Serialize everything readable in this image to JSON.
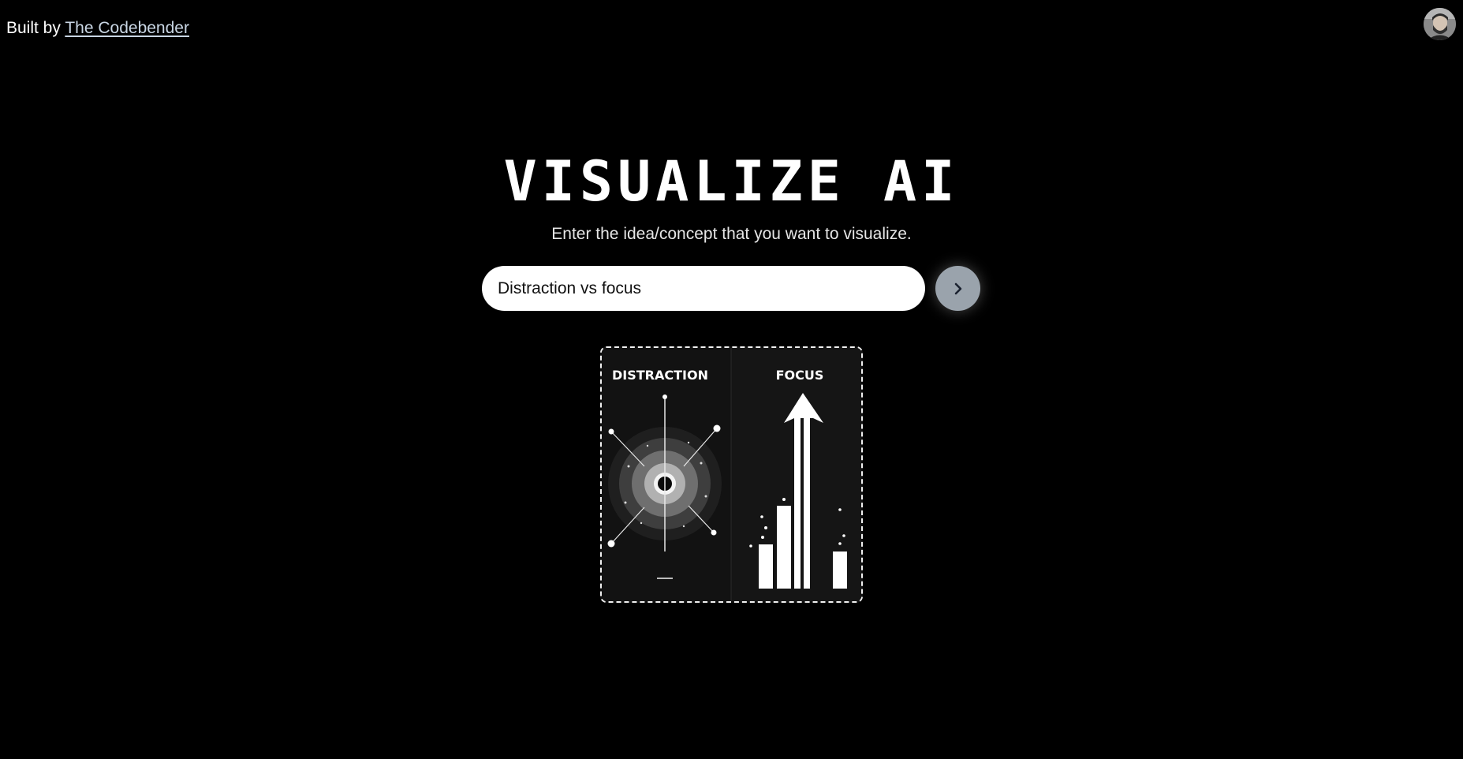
{
  "header": {
    "built_by_prefix": "Built by",
    "author_link": "The Codebender"
  },
  "hero": {
    "title": "VISUALIZE AI",
    "subtitle": "Enter the idea/concept that you want to visualize."
  },
  "search": {
    "value": "Distraction vs focus",
    "submit_icon": "chevron-right-icon"
  },
  "result": {
    "left_panel_label": "DISTRACTION",
    "right_panel_label": "FOCUS"
  },
  "colors": {
    "background": "#000000",
    "input_background": "#ffffff",
    "submit_button": "#9aa3ac",
    "link": "#c9d6e4"
  }
}
